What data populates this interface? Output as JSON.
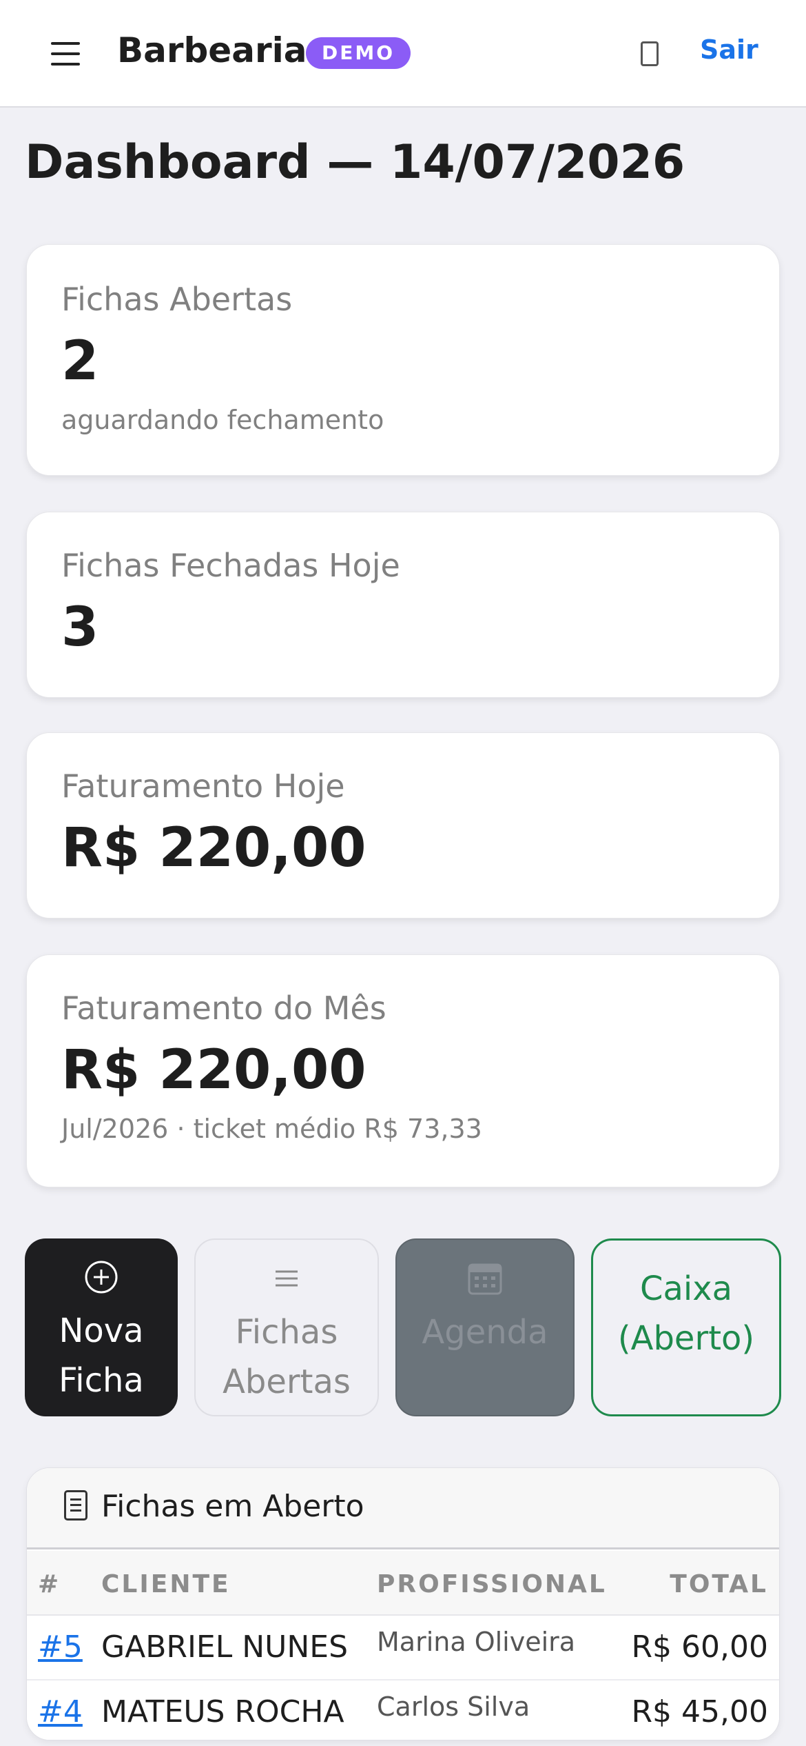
{
  "header": {
    "brand": "Barbearia",
    "badge": "DEMO",
    "logout_label": "Sair"
  },
  "page_title": "Dashboard — 14/07/2026",
  "cards": {
    "open": {
      "label": "Fichas Abertas",
      "value": "2",
      "sub": "aguardando fechamento"
    },
    "closed_today": {
      "label": "Fichas Fechadas Hoje",
      "value": "3"
    },
    "revenue_today": {
      "label": "Faturamento Hoje",
      "value": "R$ 220,00"
    },
    "revenue_month": {
      "label": "Faturamento do Mês",
      "value": "R$ 220,00",
      "sub": "Jul/2026 · ticket médio R$ 73,33"
    }
  },
  "actions": {
    "new_ticket": "Nova\nFicha",
    "open_tickets": "Fichas\nAbertas",
    "agenda": "Agenda",
    "cashier": "Caixa\n(Aberto)"
  },
  "open_table": {
    "title": "Fichas em Aberto",
    "columns": {
      "id": "#",
      "client": "CLIENTE",
      "professional": "PROFISSIONAL",
      "total": "TOTAL"
    },
    "rows": [
      {
        "id": "#5",
        "client": "GABRIEL NUNES",
        "professional": "Marina Oliveira",
        "total": "R$ 60,00"
      },
      {
        "id": "#4",
        "client": "MATEUS ROCHA",
        "professional": "Carlos Silva",
        "total": "R$ 45,00"
      }
    ]
  },
  "colors": {
    "accent_blue": "#1a73e8",
    "demo_badge": "#8b5cf6",
    "cashier_green": "#1e8a4c",
    "dark_button": "#1e1e20"
  },
  "icons": [
    "menu-icon",
    "moon-icon",
    "plus-circle-icon",
    "list-icon",
    "calendar-icon",
    "document-icon"
  ]
}
